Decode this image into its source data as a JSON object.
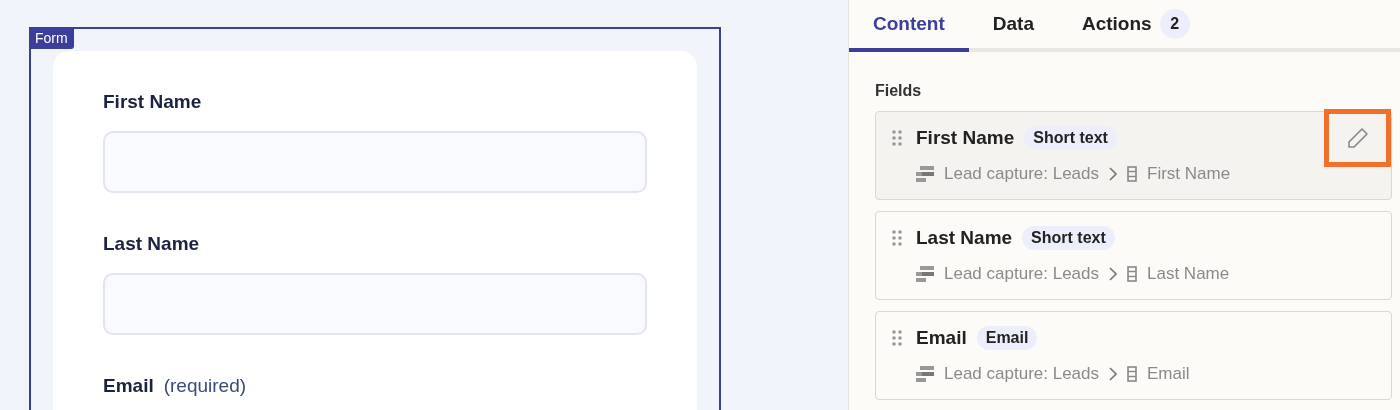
{
  "form": {
    "badge": "Form",
    "fields": [
      {
        "label": "First Name"
      },
      {
        "label": "Last Name"
      },
      {
        "label": "Email",
        "note": "(required)"
      }
    ]
  },
  "tabs": [
    {
      "label": "Content",
      "selected": true
    },
    {
      "label": "Data",
      "selected": false
    },
    {
      "label": "Actions",
      "selected": false,
      "count": "2"
    }
  ],
  "section_title": "Fields",
  "fields": [
    {
      "name": "First Name",
      "type": "Short text",
      "source": "Lead capture: Leads",
      "column": "First Name",
      "hovered": true
    },
    {
      "name": "Last Name",
      "type": "Short text",
      "source": "Lead capture: Leads",
      "column": "Last Name",
      "hovered": false
    },
    {
      "name": "Email",
      "type": "Email",
      "source": "Lead capture: Leads",
      "column": "Email",
      "hovered": false
    }
  ]
}
